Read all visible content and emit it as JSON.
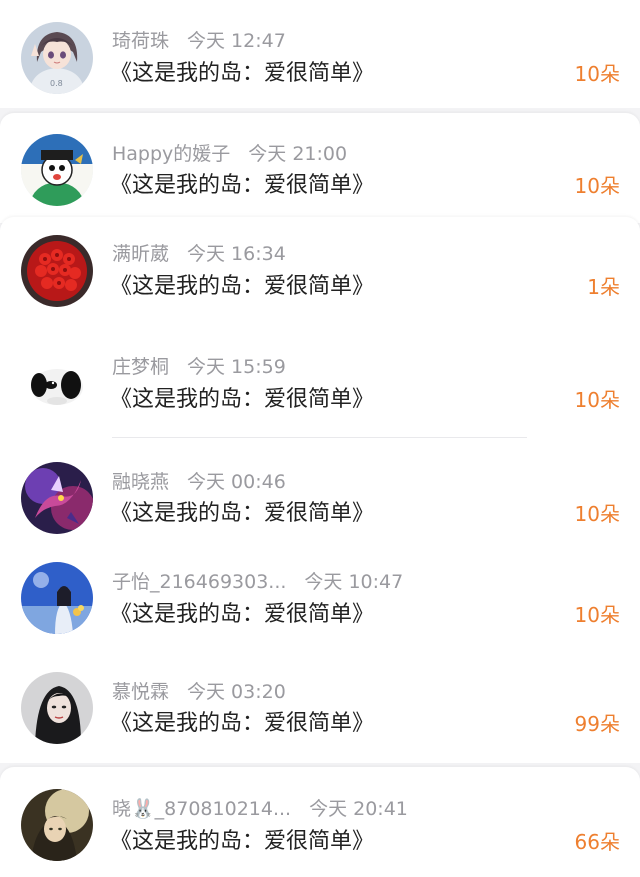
{
  "colors": {
    "flower_count": "#ee7f2f",
    "name": "#9a9a9f",
    "title": "#222222",
    "background": "#f3f3f5"
  },
  "gifts": [
    {
      "avatar": "anime-girl-avatar",
      "name": "琦荷珠",
      "time": "今天 12:47",
      "title": "《这是我的岛：爱很简单》",
      "count": "10朵"
    },
    {
      "avatar": "cartoon-character-avatar",
      "name": "Happy的媛子",
      "time": "今天 21:00",
      "title": "《这是我的岛：爱很简单》",
      "count": "10朵"
    },
    {
      "avatar": "red-roses-avatar",
      "name": "满昕葳",
      "time": "今天 16:34",
      "title": "《这是我的岛：爱很简单》",
      "count": "1朵"
    },
    {
      "avatar": "panda-avatar",
      "name": "庄梦桐",
      "time": "今天 15:59",
      "title": "《这是我的岛：爱很简单》",
      "count": "10朵"
    },
    {
      "avatar": "dragon-art-avatar",
      "name": "融晓燕",
      "time": "今天 00:46",
      "title": "《这是我的岛：爱很简单》",
      "count": "10朵"
    },
    {
      "avatar": "girl-with-flowers-avatar",
      "name": "子怡_216469303...",
      "time": "今天 10:47",
      "title": "《这是我的岛：爱很简单》",
      "count": "10朵"
    },
    {
      "avatar": "woman-portrait-avatar",
      "name": "慕悦霖",
      "time": "今天 03:20",
      "title": "《这是我的岛：爱很简单》",
      "count": "99朵"
    },
    {
      "avatar": "sunlit-portrait-avatar",
      "name": "晓🐰_870810214...",
      "time": "今天 20:41",
      "title": "《这是我的岛：爱很简单》",
      "count": "66朵"
    }
  ]
}
